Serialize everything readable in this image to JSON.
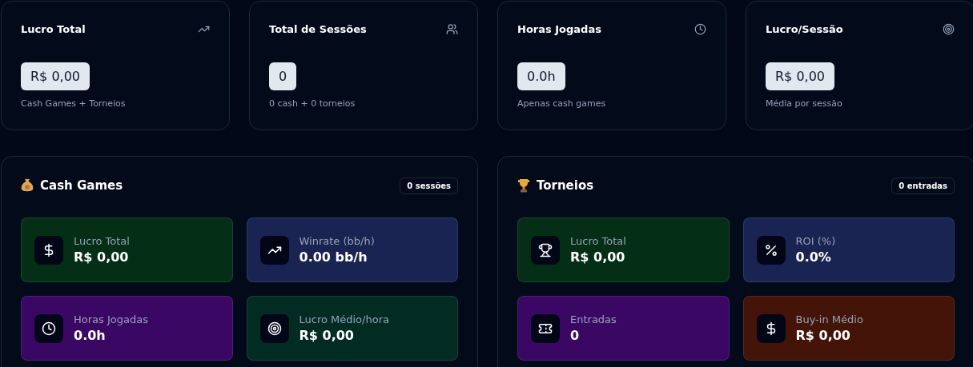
{
  "summary_cards": [
    {
      "title": "Lucro Total",
      "value": "R$ 0,00",
      "subtitle": "Cash Games + Torneios"
    },
    {
      "title": "Total de Sessões",
      "value": "0",
      "subtitle": "0 cash + 0 torneios"
    },
    {
      "title": "Horas Jogadas",
      "value": "0.0h",
      "subtitle": "Apenas cash games"
    },
    {
      "title": "Lucro/Sessão",
      "value": "R$ 0,00",
      "subtitle": "Média por sessão"
    }
  ],
  "panels": [
    {
      "title": "Cash Games",
      "badge": "0 sessões",
      "stats": [
        {
          "label": "Lucro Total",
          "value": "R$ 0,00",
          "color": "#052e16"
        },
        {
          "label": "Winrate (bb/h)",
          "value": "0.00 bb/h",
          "color": "#1a2453"
        },
        {
          "label": "Horas Jogadas",
          "value": "0.0h",
          "color": "#3b0764"
        },
        {
          "label": "Lucro Médio/hora",
          "value": "R$ 0,00",
          "color": "#022c22"
        }
      ]
    },
    {
      "title": "Torneios",
      "badge": "0 entradas",
      "stats": [
        {
          "label": "Lucro Total",
          "value": "R$ 0,00",
          "color": "#052e16"
        },
        {
          "label": "ROI (%)",
          "value": "0.0%",
          "color": "#1a2453"
        },
        {
          "label": "Entradas",
          "value": "0",
          "color": "#3b0764"
        },
        {
          "label": "Buy-in Médio",
          "value": "R$ 0,00",
          "color": "#431407"
        }
      ]
    }
  ]
}
